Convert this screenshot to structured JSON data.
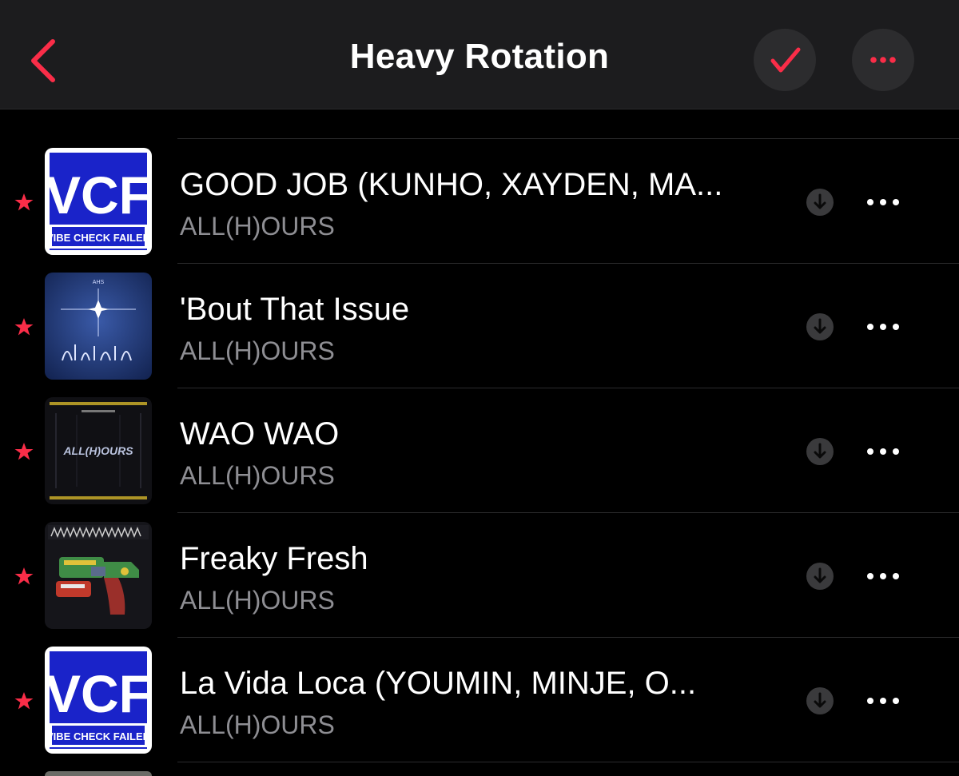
{
  "header": {
    "title": "Heavy Rotation",
    "back_icon": "chevron-left-icon",
    "select_icon": "checkmark-icon",
    "more_icon": "ellipsis-icon",
    "accent_color": "#fa2d48"
  },
  "songs": [
    {
      "title": "GOOD JOB (KUNHO, XAYDEN, MA...",
      "artist": "ALL(H)OURS",
      "favorite": true,
      "artwork": "vcf-cover",
      "artwork_text": [
        "VCF",
        "VIBE CHECK FAILED"
      ]
    },
    {
      "title": "'Bout That Issue",
      "artist": "ALL(H)OURS",
      "favorite": true,
      "artwork": "blue-star-cover"
    },
    {
      "title": "WAO WAO",
      "artist": "ALL(H)OURS",
      "favorite": true,
      "artwork": "allhours-dark-cover"
    },
    {
      "title": "Freaky Fresh",
      "artist": "ALL(H)OURS",
      "favorite": true,
      "artwork": "water-gun-cover"
    },
    {
      "title": "La Vida Loca (YOUMIN, MINJE, O...",
      "artist": "ALL(H)OURS",
      "favorite": true,
      "artwork": "vcf-cover",
      "artwork_text": [
        "VCF",
        "VIBE CHECK FAILED"
      ]
    }
  ]
}
